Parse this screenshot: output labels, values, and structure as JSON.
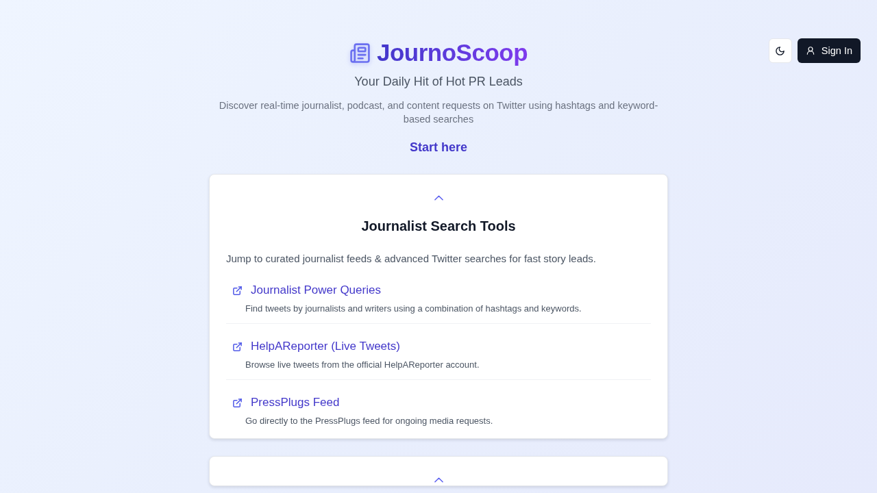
{
  "top_bar": {
    "sign_in_button": {
      "label": "Sign In"
    }
  },
  "header": {
    "title": "JournoScoop",
    "tagline": "Your Daily Hit of Hot PR Leads",
    "description": "Discover real-time journalist, podcast, and content requests on Twitter using hashtags and keyword-based searches",
    "cta": "Start here"
  },
  "cards": [
    {
      "expanded": true,
      "title": "Journalist Search Tools",
      "description": "Jump to curated journalist feeds & advanced Twitter searches for fast story leads.",
      "links": [
        {
          "title": "Journalist Power Queries",
          "description": "Find tweets by journalists and writers using a combination of hashtags and keywords."
        },
        {
          "title": "HelpAReporter (Live Tweets)",
          "description": "Browse live tweets from the official HelpAReporter account."
        },
        {
          "title": "PressPlugs Feed",
          "description": "Go directly to the PressPlugs feed for ongoing media requests."
        }
      ]
    },
    {
      "expanded": true
    }
  ]
}
